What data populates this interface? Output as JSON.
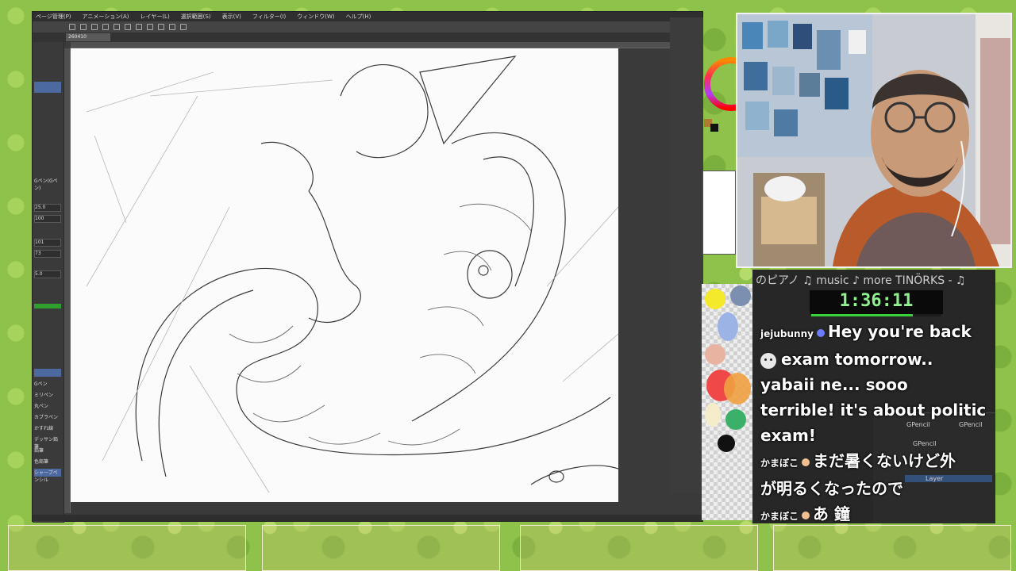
{
  "app": {
    "menu": [
      "ページ管理(P)",
      "アニメーション(A)",
      "レイヤー(L)",
      "選択範囲(S)",
      "表示(V)",
      "フィルター(I)",
      "ウィンドウ(W)",
      "ヘルプ(H)"
    ],
    "document_tab": "260410"
  },
  "left_panel": {
    "brush_label": "Gペン(Gペン)",
    "sizes": [
      "25.0",
      "100",
      "5.0",
      "101",
      "73"
    ],
    "subtools": [
      "Gペン",
      "ミリペン",
      "丸ペン",
      "カブラペン",
      "かすれ線",
      "デッサン鉛筆",
      "鉛筆",
      "色鉛筆",
      "シャープペンシル"
    ]
  },
  "stream": {
    "now_playing": "のピアノ      ♫ music ♪ more TINÖRKS - ♫",
    "timer": "1:36:11",
    "timer_progress": 0.78
  },
  "chat": {
    "messages": [
      {
        "user": "jejubunny",
        "text": "Hey you're back"
      },
      {
        "user": "",
        "text": "exam tomorrow.."
      },
      {
        "user": "",
        "text": "yabaii ne... sooo"
      },
      {
        "user": "",
        "text": "terrible! it's about politic"
      },
      {
        "user": "",
        "text": "exam!"
      },
      {
        "user": "かまぼこ",
        "text": "まだ暑くないけど外"
      },
      {
        "user": "",
        "text": "が明るくなったので"
      },
      {
        "user": "かまぼこ",
        "text": "あ 鐘"
      }
    ]
  },
  "blender": {
    "breadcrumb_a": "GPencil",
    "breadcrumb_b": "GPencil",
    "object": "GPencil",
    "layer": "Layer"
  },
  "colors": {
    "chat_bg": "#272727",
    "timer_green": "#37d13a",
    "backdrop": "#8fc24a"
  }
}
